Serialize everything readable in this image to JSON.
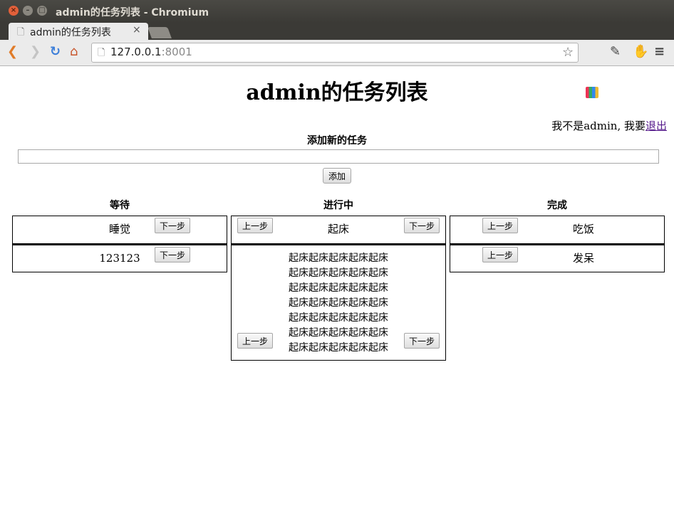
{
  "window": {
    "title": "admin的任务列表 - Chromium",
    "close_glyph": "×",
    "min_glyph": "–",
    "max_glyph": "□"
  },
  "browser": {
    "tab_title": "admin的任务列表",
    "tab_close": "×",
    "url_host": "127.0.0.1",
    "url_port": ":8001",
    "icons": {
      "back": "❮",
      "forward": "❯",
      "reload": "↻",
      "home": "⌂",
      "page": "🗋",
      "star": "☆",
      "ext2": "✎",
      "ext3": "✋",
      "menu": "≡"
    }
  },
  "page": {
    "title": "admin的任务列表",
    "user_line_prefix": "我不是admin, 我要",
    "logout_link": "退出",
    "add_heading": "添加新的任务",
    "task_input_value": "",
    "add_button": "添加",
    "prev_label": "上一步",
    "next_label": "下一步"
  },
  "columns": {
    "wait": {
      "heading": "等待",
      "tasks": [
        "睡觉",
        "123123"
      ]
    },
    "doing": {
      "heading": "进行中",
      "tasks": [
        "起床",
        "起床起床起床起床起床起床起床起床起床起床起床起床起床起床起床起床起床起床起床起床起床起床起床起床起床起床起床起床起床起床起床起床起床起床起床"
      ]
    },
    "done": {
      "heading": "完成",
      "tasks": [
        "吃饭",
        "发呆"
      ]
    }
  }
}
